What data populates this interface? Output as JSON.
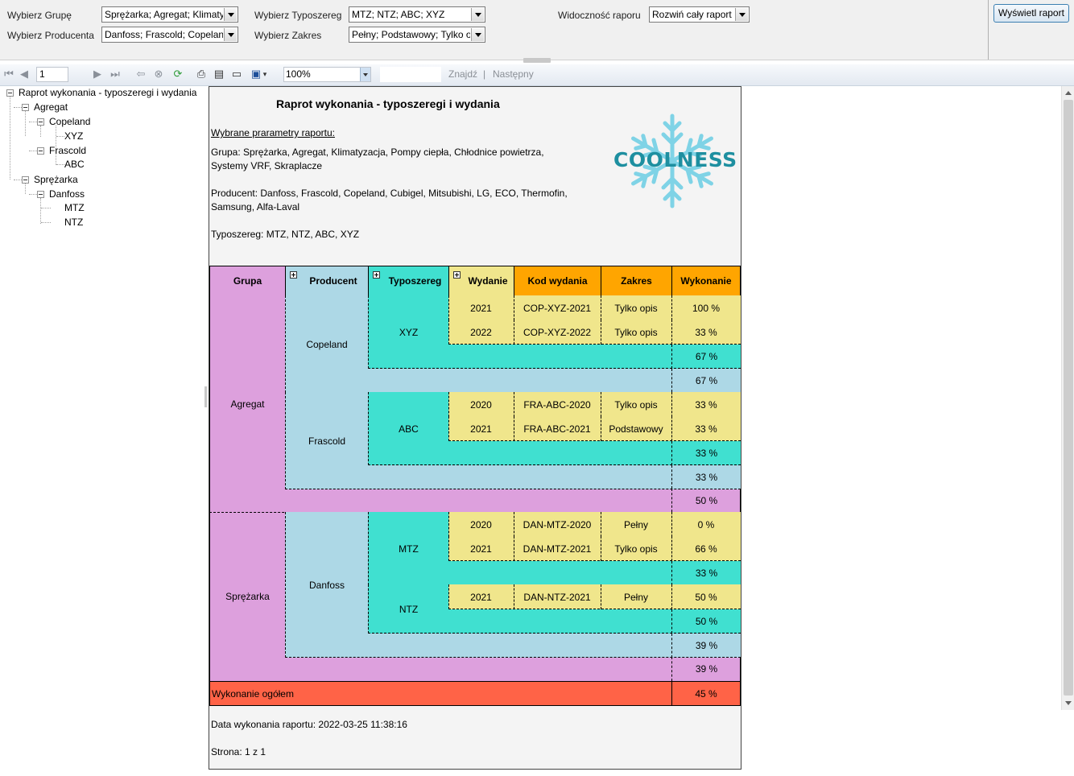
{
  "params": {
    "group_label": "Wybierz Grupę",
    "group_value": "Sprężarka; Agregat; Klimatyzacja; Pompy ciepła; Chłodnice powietrza; Systemy VRF; Skraplacze",
    "producer_label": "Wybierz Producenta",
    "producer_value": "Danfoss; Frascold; Copeland; Cubigel; Mitsubishi; LG; ECO; Thermofin; Samsung; Alfa-Laval",
    "series_label": "Wybierz Typoszereg",
    "series_value": "MTZ; NTZ; ABC; XYZ",
    "range_label": "Wybierz Zakres",
    "range_value": "Pełny; Podstawowy; Tylko opis",
    "visibility_label": "Widoczność raporu",
    "visibility_value": "Rozwiń cały raport",
    "view_button": "Wyświetl raport"
  },
  "toolbar": {
    "page_number": "1",
    "zoom": "100%",
    "find_label": "Znajdź",
    "next_label": "Następny",
    "separator": "|",
    "icons": [
      "first-page-icon",
      "prev-page-icon",
      "next-page-icon",
      "last-page-icon",
      "back-icon",
      "stop-icon",
      "refresh-icon",
      "print-icon",
      "page-setup-icon",
      "print-layout-icon",
      "export-icon"
    ]
  },
  "doc_map": {
    "root": "Raprot wykonania - typoszeregi i wydania",
    "nodes": [
      "Agregat",
      "Copeland",
      "XYZ",
      "Frascold",
      "ABC",
      "Sprężarka",
      "Danfoss",
      "MTZ",
      "NTZ"
    ]
  },
  "report": {
    "title": "Raprot wykonania - typoszeregi i wydania",
    "params_heading": "Wybrane prarametry raportu:",
    "group_line1": "Grupa: Sprężarka, Agregat, Klimatyzacja, Pompy ciepła, Chłodnice powietrza,",
    "group_line2": "Systemy VRF, Skraplacze",
    "producer_line1": "Producent: Danfoss, Frascold, Copeland, Cubigel, Mitsubishi, LG, ECO, Thermofin,",
    "producer_line2": "Samsung, Alfa-Laval",
    "series_line": "Typoszereg: MTZ, NTZ, ABC, XYZ",
    "logo_text": "COOLNESS",
    "headers": {
      "group": "Grupa",
      "producer": "Producent",
      "series": "Typoszereg",
      "edition": "Wydanie",
      "code": "Kod wydania",
      "range": "Zakres",
      "execution": "Wykonanie"
    },
    "groups": [
      "Agregat",
      "Sprężarka"
    ],
    "producers": [
      "Copeland",
      "Frascold",
      "Danfoss"
    ],
    "series": [
      "XYZ",
      "ABC",
      "MTZ",
      "NTZ"
    ],
    "rows": [
      {
        "edition": "2021",
        "code": "COP-XYZ-2021",
        "range": "Tylko opis",
        "execution": "100 %"
      },
      {
        "edition": "2022",
        "code": "COP-XYZ-2022",
        "range": "Tylko opis",
        "execution": "33 %"
      },
      {
        "edition": "2020",
        "code": "FRA-ABC-2020",
        "range": "Tylko opis",
        "execution": "33 %"
      },
      {
        "edition": "2021",
        "code": "FRA-ABC-2021",
        "range": "Podstawowy",
        "execution": "33 %"
      },
      {
        "edition": "2020",
        "code": "DAN-MTZ-2020",
        "range": "Pełny",
        "execution": "0 %"
      },
      {
        "edition": "2021",
        "code": "DAN-MTZ-2021",
        "range": "Tylko opis",
        "execution": "66 %"
      },
      {
        "edition": "2021",
        "code": "DAN-NTZ-2021",
        "range": "Pełny",
        "execution": "50 %"
      }
    ],
    "subtotals": {
      "xyz": "67 %",
      "copeland": "67 %",
      "abc": "33 %",
      "frascold": "33 %",
      "agregat": "50 %",
      "mtz": "33 %",
      "ntz": "50 %",
      "danfoss": "39 %",
      "sprezarka": "39 %"
    },
    "total_label": "Wykonanie ogółem",
    "total_value": "45 %",
    "date_line": "Data wykonania raportu: 2022-03-25 11:38:16",
    "page_line": "Strona: 1 z 1"
  },
  "colors": {
    "group": "#dda0dd",
    "producer": "#add8e6",
    "series": "#40e0d0",
    "edition": "#f0e68c",
    "execution_header": "#ffa500",
    "total": "#ff6347",
    "logo": "#1e8fa0"
  }
}
